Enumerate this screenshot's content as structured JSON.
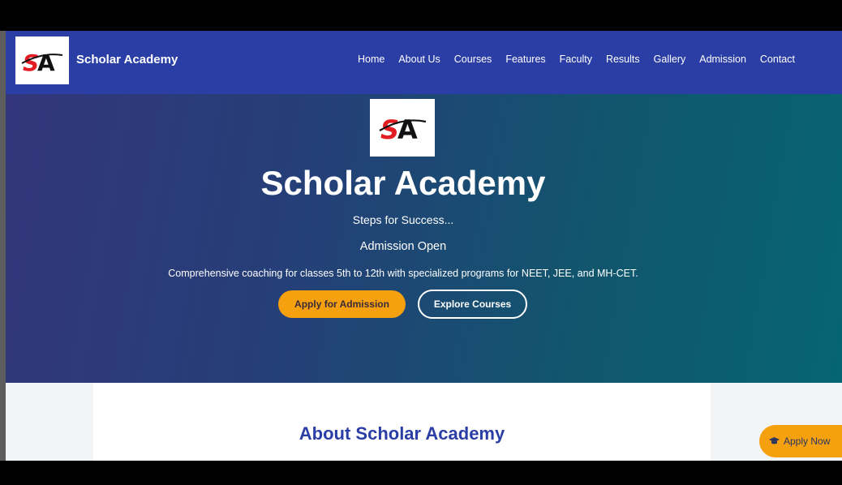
{
  "brand": {
    "logo_text": "SA",
    "name": "Scholar Academy"
  },
  "nav": {
    "items": [
      {
        "label": "Home"
      },
      {
        "label": "About Us"
      },
      {
        "label": "Courses"
      },
      {
        "label": "Features"
      },
      {
        "label": "Faculty"
      },
      {
        "label": "Results"
      },
      {
        "label": "Gallery"
      },
      {
        "label": "Admission"
      },
      {
        "label": "Contact"
      }
    ]
  },
  "hero": {
    "title": "Scholar Academy",
    "tagline": "Steps for Success...",
    "admission": "Admission Open",
    "description": "Comprehensive coaching for classes 5th to 12th with specialized programs for NEET, JEE, and MH-CET.",
    "apply_button": "Apply for Admission",
    "explore_button": "Explore Courses"
  },
  "about": {
    "title": "About Scholar Academy"
  },
  "floating": {
    "apply_now": "Apply Now",
    "icon": "graduation-cap-icon"
  },
  "colors": {
    "navbar": "#2a3ea6",
    "accent": "#f5a00e",
    "heading": "#2a3ea6"
  }
}
